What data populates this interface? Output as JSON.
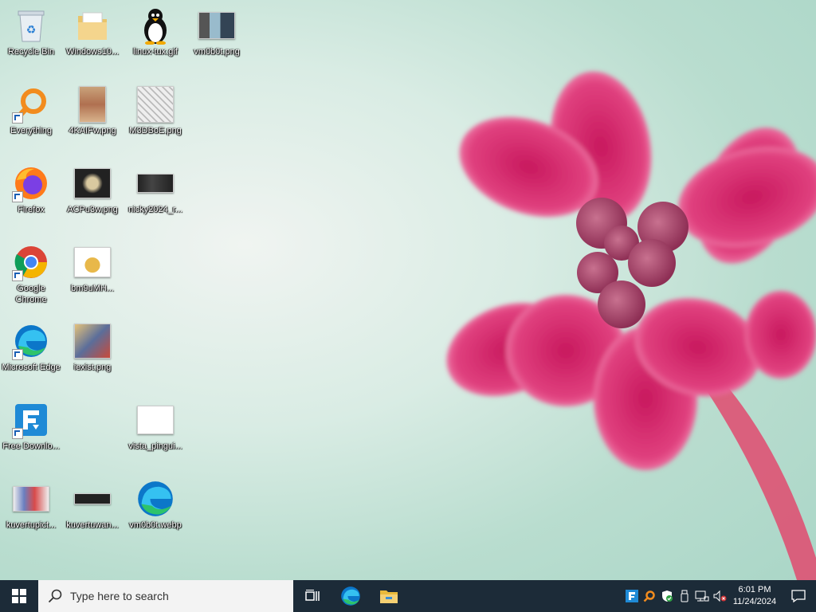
{
  "desktop": {
    "icons": [
      {
        "label": "Recycle Bin"
      },
      {
        "label": "Windows10..."
      },
      {
        "label": "linux-tux.gif"
      },
      {
        "label": "vm0b0t.png"
      },
      {
        "label": "Everything"
      },
      {
        "label": "4KAIFw.png"
      },
      {
        "label": "M3DBoE.png"
      },
      {
        "label": "Firefox"
      },
      {
        "label": "ACPu3w.png"
      },
      {
        "label": "nicky2024_r..."
      },
      {
        "label": "Google Chrome"
      },
      {
        "label": "bm9uMH..."
      },
      {
        "label": "Microsoft Edge"
      },
      {
        "label": "iexist.png"
      },
      {
        "label": "Free Downlo..."
      },
      {
        "label": "vista_pingui..."
      },
      {
        "label": "kuvertupict..."
      },
      {
        "label": "kuvertuwan..."
      },
      {
        "label": "vm0b0t.webp"
      }
    ]
  },
  "taskbar": {
    "search_placeholder": "Type here to search",
    "time": "6:01 PM",
    "date": "11/24/2024"
  },
  "colors": {
    "taskbar_bg": "#1c2b38",
    "flower_pink": "#e0407e",
    "wallpaper_mint": "#b9ddcf"
  }
}
